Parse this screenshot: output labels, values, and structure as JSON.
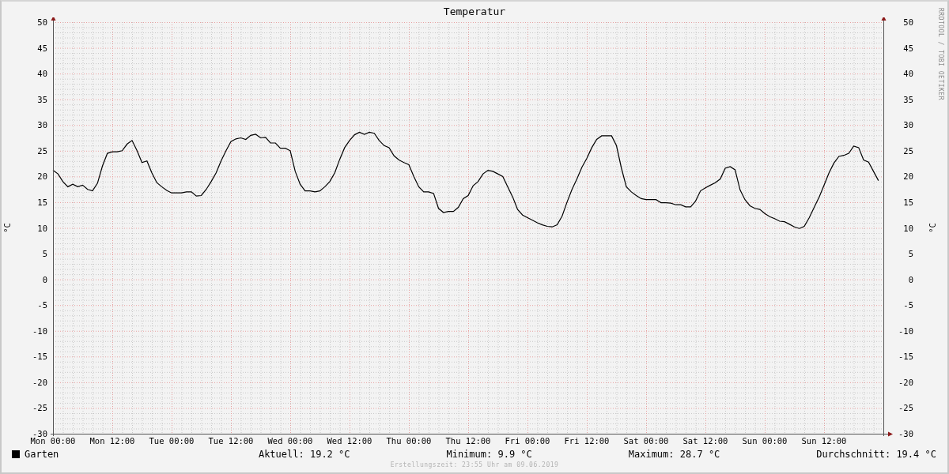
{
  "graph": {
    "chart_data": {
      "type": "line",
      "grid": true,
      "title": "Temperatur",
      "ylabel": "°C",
      "ylim": [
        -30,
        50
      ],
      "categories": [
        "Mon 00:00",
        null,
        null,
        null,
        null,
        null,
        null,
        null,
        null,
        null,
        null,
        null,
        "Mon 12:00",
        null,
        null,
        null,
        null,
        null,
        null,
        null,
        null,
        null,
        null,
        null,
        "Tue 00:00",
        null,
        null,
        null,
        null,
        null,
        null,
        null,
        null,
        null,
        null,
        null,
        "Tue 12:00",
        null,
        null,
        null,
        null,
        null,
        null,
        null,
        null,
        null,
        null,
        null,
        "Wed 00:00",
        null,
        null,
        null,
        null,
        null,
        null,
        null,
        null,
        null,
        null,
        null,
        "Wed 12:00",
        null,
        null,
        null,
        null,
        null,
        null,
        null,
        null,
        null,
        null,
        null,
        "Thu 00:00",
        null,
        null,
        null,
        null,
        null,
        null,
        null,
        null,
        null,
        null,
        null,
        "Thu 12:00",
        null,
        null,
        null,
        null,
        null,
        null,
        null,
        null,
        null,
        null,
        null,
        "Fri 00:00",
        null,
        null,
        null,
        null,
        null,
        null,
        null,
        null,
        null,
        null,
        null,
        "Fri 12:00",
        null,
        null,
        null,
        null,
        null,
        null,
        null,
        null,
        null,
        null,
        null,
        "Sat 00:00",
        null,
        null,
        null,
        null,
        null,
        null,
        null,
        null,
        null,
        null,
        null,
        "Sat 12:00",
        null,
        null,
        null,
        null,
        null,
        null,
        null,
        null,
        null,
        null,
        null,
        "Sun 00:00",
        null,
        null,
        null,
        null,
        null,
        null,
        null,
        null,
        null,
        null,
        null,
        "Sun 12:00",
        null,
        null,
        null,
        null,
        null,
        null,
        null,
        null,
        null,
        null,
        null
      ],
      "series": [
        {
          "name": "Garten",
          "color": "#000000",
          "values": [
            21.2,
            20.5,
            19,
            18,
            18.5,
            18,
            18.3,
            17.5,
            17.2,
            18.7,
            22,
            24.5,
            24.8,
            24.8,
            25,
            26.3,
            27,
            25,
            22.7,
            23,
            20.7,
            18.8,
            18,
            17.3,
            16.8,
            16.8,
            16.8,
            17,
            17,
            16.2,
            16.3,
            17.5,
            19,
            20.7,
            23,
            25,
            26.8,
            27.3,
            27.5,
            27.2,
            28,
            28.2,
            27.5,
            27.6,
            26.5,
            26.5,
            25.5,
            25.5,
            25,
            21,
            18.5,
            17.2,
            17.2,
            17,
            17.2,
            18,
            19,
            20.7,
            23.3,
            25.6,
            27,
            28.1,
            28.6,
            28.2,
            28.6,
            28.4,
            27,
            26,
            25.6,
            24,
            23.2,
            22.7,
            22.3,
            20,
            18,
            17,
            17,
            16.7,
            13.8,
            13,
            13.2,
            13.2,
            14,
            15.7,
            16.3,
            18.2,
            19,
            20.5,
            21.2,
            21,
            20.5,
            20,
            18,
            16,
            13.6,
            12.5,
            12,
            11.5,
            11,
            10.6,
            10.3,
            10.2,
            10.6,
            12.3,
            15,
            17.5,
            19.5,
            21.8,
            23.5,
            25.6,
            27.2,
            27.9,
            27.9,
            27.9,
            26,
            21.6,
            18,
            17,
            16.3,
            15.7,
            15.5,
            15.5,
            15.5,
            14.9,
            14.9,
            14.8,
            14.5,
            14.5,
            14.1,
            14.1,
            15.2,
            17.2,
            17.8,
            18.3,
            18.8,
            19.5,
            21.6,
            21.9,
            21.3,
            17.4,
            15.5,
            14.3,
            13.8,
            13.6,
            12.8,
            12.2,
            11.8,
            11.3,
            11.2,
            10.7,
            10.2,
            9.9,
            10.3,
            12,
            14,
            16,
            18.3,
            20.7,
            22.6,
            23.9,
            24.1,
            24.5,
            25.9,
            25.6,
            23.2,
            22.8,
            21,
            19.2
          ]
        }
      ],
      "yticks": [
        50,
        45,
        40,
        35,
        30,
        25,
        20,
        15,
        10,
        5,
        0,
        -5,
        -10,
        -15,
        -20,
        -25,
        -30
      ]
    },
    "right_ylabel": "°C",
    "right_yticks": [
      "50",
      "45",
      "40",
      "35",
      "30",
      "25",
      "20",
      "15",
      "10",
      "5",
      "0",
      "-5",
      "-10",
      "-15",
      "-20",
      "-25",
      "-30"
    ],
    "side_text": "RRDTOOL / TOBI OETIKER",
    "legend": {
      "stats": [
        "Aktuell: 19.2 °C",
        "Minimum: 9.9 °C",
        "Maximum: 28.7 °C",
        "Durchschnitt: 19.4 °C"
      ]
    },
    "footer": "Erstellungszeit: 23:55 Uhr am 09.06.2019"
  }
}
